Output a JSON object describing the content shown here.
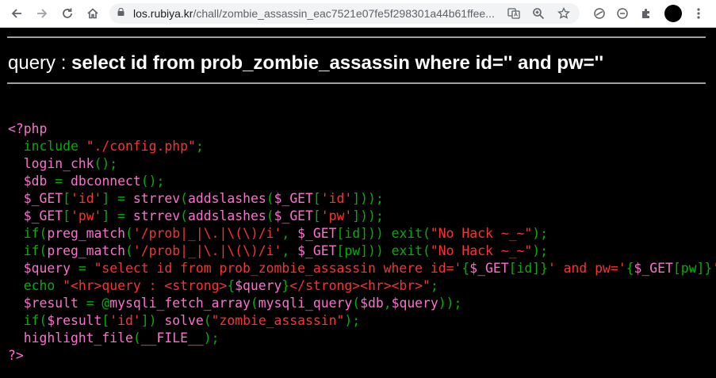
{
  "browser": {
    "url_host": "los.rubiya.kr",
    "url_path": "/chall/zombie_assassin_eac7521e07fe5f298301a44b61ffee..."
  },
  "page": {
    "query_label": "query : ",
    "query_text": "select id from prob_zombie_assassin where id='' and pw=''"
  },
  "code_lines": [
    [
      {
        "t": "<?php",
        "c": "p"
      }
    ],
    [
      {
        "t": "  include ",
        "c": "g"
      },
      {
        "t": "\"./config.php\"",
        "c": "r"
      },
      {
        "t": ";",
        "c": "g"
      }
    ],
    [
      {
        "t": "  login_chk",
        "c": "p"
      },
      {
        "t": "();",
        "c": "g"
      }
    ],
    [
      {
        "t": "  $db ",
        "c": "p"
      },
      {
        "t": "= ",
        "c": "g"
      },
      {
        "t": "dbconnect",
        "c": "p"
      },
      {
        "t": "();",
        "c": "g"
      }
    ],
    [
      {
        "t": "  $_GET",
        "c": "p"
      },
      {
        "t": "[",
        "c": "g"
      },
      {
        "t": "'id'",
        "c": "r"
      },
      {
        "t": "] = ",
        "c": "g"
      },
      {
        "t": "strrev",
        "c": "p"
      },
      {
        "t": "(",
        "c": "g"
      },
      {
        "t": "addslashes",
        "c": "p"
      },
      {
        "t": "(",
        "c": "g"
      },
      {
        "t": "$_GET",
        "c": "p"
      },
      {
        "t": "[",
        "c": "g"
      },
      {
        "t": "'id'",
        "c": "r"
      },
      {
        "t": "]));",
        "c": "g"
      }
    ],
    [
      {
        "t": "  $_GET",
        "c": "p"
      },
      {
        "t": "[",
        "c": "g"
      },
      {
        "t": "'pw'",
        "c": "r"
      },
      {
        "t": "] = ",
        "c": "g"
      },
      {
        "t": "strrev",
        "c": "p"
      },
      {
        "t": "(",
        "c": "g"
      },
      {
        "t": "addslashes",
        "c": "p"
      },
      {
        "t": "(",
        "c": "g"
      },
      {
        "t": "$_GET",
        "c": "p"
      },
      {
        "t": "[",
        "c": "g"
      },
      {
        "t": "'pw'",
        "c": "r"
      },
      {
        "t": "]));",
        "c": "g"
      }
    ],
    [
      {
        "t": "  if(",
        "c": "g"
      },
      {
        "t": "preg_match",
        "c": "p"
      },
      {
        "t": "(",
        "c": "g"
      },
      {
        "t": "'/prob|_|\\.|\\(\\)/i'",
        "c": "r"
      },
      {
        "t": ", ",
        "c": "g"
      },
      {
        "t": "$_GET",
        "c": "p"
      },
      {
        "t": "[id])) ",
        "c": "g"
      },
      {
        "t": "exit(",
        "c": "g"
      },
      {
        "t": "\"No Hack ~_~\"",
        "c": "r"
      },
      {
        "t": ");",
        "c": "g"
      }
    ],
    [
      {
        "t": "  if(",
        "c": "g"
      },
      {
        "t": "preg_match",
        "c": "p"
      },
      {
        "t": "(",
        "c": "g"
      },
      {
        "t": "'/prob|_|\\.|\\(\\)/i'",
        "c": "r"
      },
      {
        "t": ", ",
        "c": "g"
      },
      {
        "t": "$_GET",
        "c": "p"
      },
      {
        "t": "[pw])) ",
        "c": "g"
      },
      {
        "t": "exit(",
        "c": "g"
      },
      {
        "t": "\"No Hack ~_~\"",
        "c": "r"
      },
      {
        "t": ");",
        "c": "g"
      }
    ],
    [
      {
        "t": "  $query ",
        "c": "p"
      },
      {
        "t": "= ",
        "c": "g"
      },
      {
        "t": "\"select id from prob_zombie_assassin where id='",
        "c": "r"
      },
      {
        "t": "{",
        "c": "g"
      },
      {
        "t": "$_GET",
        "c": "p"
      },
      {
        "t": "[id]",
        "c": "g"
      },
      {
        "t": "}",
        "c": "g"
      },
      {
        "t": "' and pw='",
        "c": "r"
      },
      {
        "t": "{",
        "c": "g"
      },
      {
        "t": "$_GET",
        "c": "p"
      },
      {
        "t": "[pw]",
        "c": "g"
      },
      {
        "t": "}",
        "c": "g"
      },
      {
        "t": "'\"",
        "c": "r"
      }
    ],
    [
      {
        "t": "  echo ",
        "c": "g"
      },
      {
        "t": "\"<hr>query : <strong>",
        "c": "r"
      },
      {
        "t": "{",
        "c": "g"
      },
      {
        "t": "$query",
        "c": "p"
      },
      {
        "t": "}",
        "c": "g"
      },
      {
        "t": "</strong><hr><br>\"",
        "c": "r"
      },
      {
        "t": ";",
        "c": "g"
      }
    ],
    [
      {
        "t": "  $result ",
        "c": "p"
      },
      {
        "t": "= @",
        "c": "g"
      },
      {
        "t": "mysqli_fetch_array",
        "c": "p"
      },
      {
        "t": "(",
        "c": "g"
      },
      {
        "t": "mysqli_query",
        "c": "p"
      },
      {
        "t": "(",
        "c": "g"
      },
      {
        "t": "$db",
        "c": "p"
      },
      {
        "t": ",",
        "c": "g"
      },
      {
        "t": "$query",
        "c": "p"
      },
      {
        "t": "));",
        "c": "g"
      }
    ],
    [
      {
        "t": "  if(",
        "c": "g"
      },
      {
        "t": "$result",
        "c": "p"
      },
      {
        "t": "[",
        "c": "g"
      },
      {
        "t": "'id'",
        "c": "r"
      },
      {
        "t": "]) ",
        "c": "g"
      },
      {
        "t": "solve",
        "c": "p"
      },
      {
        "t": "(",
        "c": "g"
      },
      {
        "t": "\"zombie_assassin\"",
        "c": "r"
      },
      {
        "t": ");",
        "c": "g"
      }
    ],
    [
      {
        "t": "  highlight_file",
        "c": "p"
      },
      {
        "t": "(",
        "c": "g"
      },
      {
        "t": "__FILE__",
        "c": "p"
      },
      {
        "t": ");",
        "c": "g"
      }
    ],
    [
      {
        "t": "?>",
        "c": "p"
      }
    ]
  ]
}
